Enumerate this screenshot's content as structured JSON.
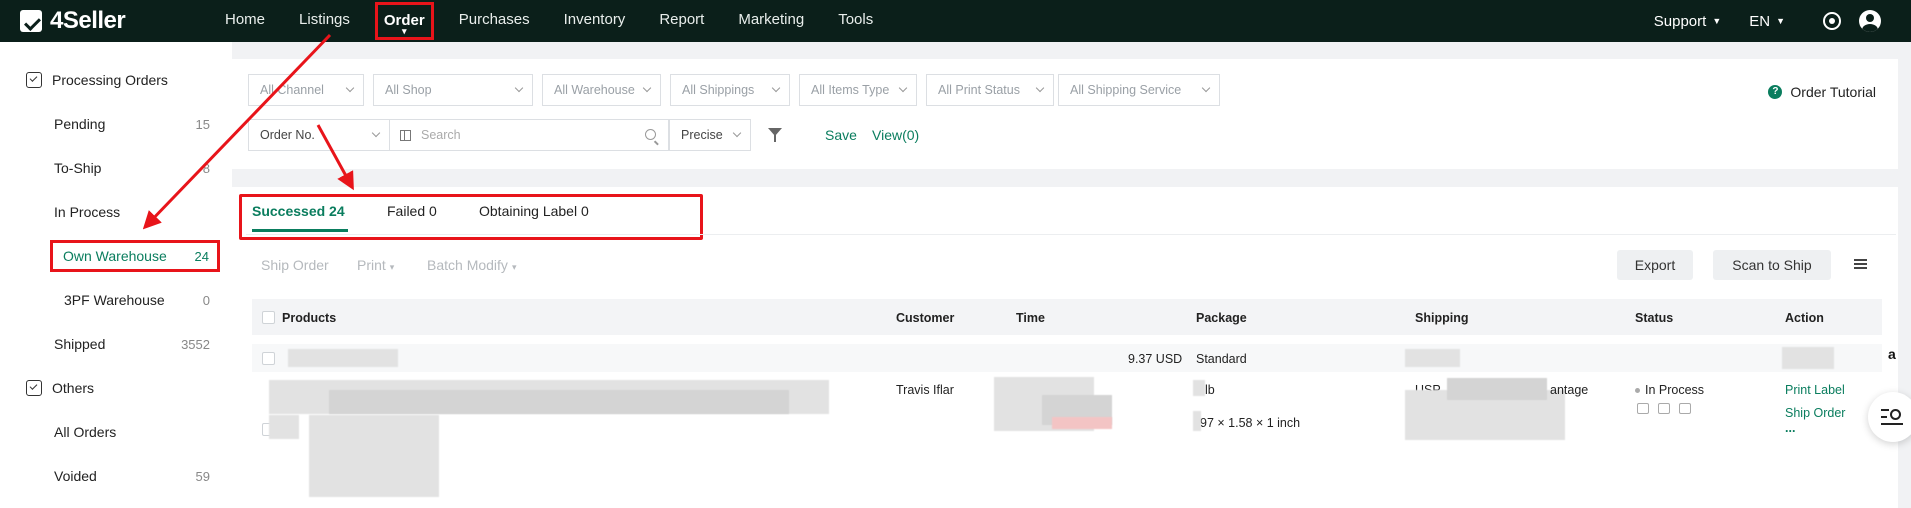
{
  "header": {
    "logo": "4Seller",
    "nav": [
      "Home",
      "Listings",
      "Order",
      "Purchases",
      "Inventory",
      "Report",
      "Marketing",
      "Tools"
    ],
    "active_nav": "Order",
    "support": "Support",
    "language": "EN"
  },
  "sidebar": {
    "group1": "Processing Orders",
    "items1": [
      {
        "label": "Pending",
        "count": "15"
      },
      {
        "label": "To-Ship",
        "count": "8"
      },
      {
        "label": "In Process",
        "count": ""
      },
      {
        "label": "Own Warehouse",
        "count": "24"
      },
      {
        "label": "3PF Warehouse",
        "count": "0"
      },
      {
        "label": "Shipped",
        "count": "3552"
      }
    ],
    "group2": "Others",
    "items2": [
      {
        "label": "All Orders",
        "count": ""
      },
      {
        "label": "Voided",
        "count": "59"
      }
    ]
  },
  "filters": {
    "selects": [
      "All Channel",
      "All Shop",
      "All Warehouse",
      "All Shippings",
      "All Items Type",
      "All Print Status",
      "All Shipping Service"
    ],
    "order_no": "Order No.",
    "search_placeholder": "Search",
    "precise": "Precise",
    "save": "Save",
    "view": "View(0)",
    "tutorial": "Order Tutorial"
  },
  "tabs": [
    "Successed 24",
    "Failed 0",
    "Obtaining Label 0"
  ],
  "toolbar": {
    "ship_order": "Ship Order",
    "print": "Print",
    "batch_modify": "Batch Modify",
    "export": "Export",
    "scan_to_ship": "Scan to Ship"
  },
  "table": {
    "headers": [
      "Products",
      "Customer",
      "Time",
      "Package",
      "Shipping",
      "Status",
      "Action"
    ],
    "row": {
      "amount": "9.37 USD",
      "package_type": "Standard",
      "channel_icon": "a",
      "customer": "Travis Iflar",
      "weight": "lb",
      "dimensions": "97 × 1.58 × 1 inch",
      "shipping_carrier": "USP",
      "shipping_service": "antage",
      "status": "In Process",
      "actions": [
        "Print Label",
        "Ship Order",
        "..."
      ]
    }
  },
  "colors": {
    "brand_dark": "#0b1f1a",
    "accent": "#0a7d5e",
    "annotation": "#e8141a"
  }
}
